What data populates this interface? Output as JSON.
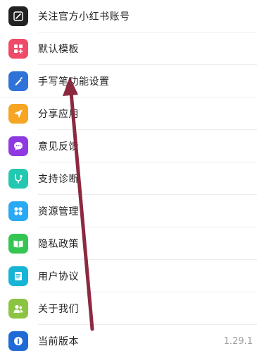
{
  "colors": {
    "notes_icon": "#222222",
    "template_icon": "#ef4a67",
    "pen_icon": "#2f73d9",
    "share_icon": "#f6a623",
    "feedback_icon": "#8e3ae0",
    "diagnosis_icon": "#22c8b0",
    "resources_icon": "#2aa9f5",
    "privacy_icon": "#35c553",
    "agreement_icon": "#17b4d6",
    "about_icon": "#8bc441",
    "version_icon": "#1e6ad6",
    "annotation_arrow": "#8c2940"
  },
  "menu": {
    "items": [
      {
        "label": "关注官方小红书账号",
        "icon": "notebook-pen-icon"
      },
      {
        "label": "默认模板",
        "icon": "template-grid-icon"
      },
      {
        "label": "手写笔功能设置",
        "icon": "stylus-icon"
      },
      {
        "label": "分享应用",
        "icon": "paper-plane-icon"
      },
      {
        "label": "意见反馈",
        "icon": "chat-bubble-icon"
      },
      {
        "label": "支持诊断",
        "icon": "stethoscope-icon"
      },
      {
        "label": "资源管理",
        "icon": "four-circles-icon"
      },
      {
        "label": "隐私政策",
        "icon": "open-book-icon"
      },
      {
        "label": "用户协议",
        "icon": "document-icon"
      },
      {
        "label": "关于我们",
        "icon": "people-icon"
      },
      {
        "label": "当前版本",
        "icon": "info-icon"
      }
    ],
    "version_value": "1.29.1"
  }
}
